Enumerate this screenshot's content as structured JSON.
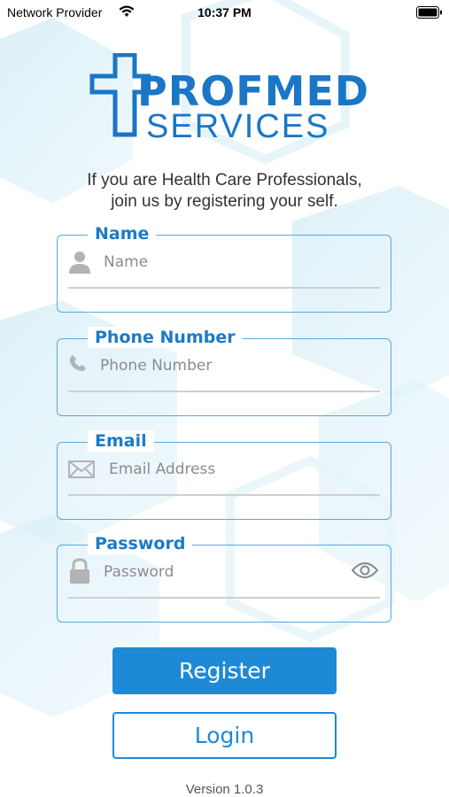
{
  "status_bar": {
    "carrier": "Network Provider",
    "time": "10:37 PM"
  },
  "logo": {
    "line1": "PROFMED",
    "line2": "SERVICES"
  },
  "tagline": {
    "line1": "If you are Health Care Professionals,",
    "line2": "join us by registering your self."
  },
  "form": {
    "name": {
      "label": "Name",
      "placeholder": "Name",
      "icon": "person-icon"
    },
    "phone": {
      "label": "Phone Number",
      "placeholder": "Phone Number",
      "icon": "phone-icon"
    },
    "email": {
      "label": "Email",
      "placeholder": "Email Address",
      "icon": "envelope-icon"
    },
    "password": {
      "label": "Password",
      "placeholder": "Password",
      "icon": "lock-icon",
      "toggle_icon": "eye-icon"
    }
  },
  "buttons": {
    "register": "Register",
    "login": "Login"
  },
  "footer": {
    "version": "Version 1.0.3"
  },
  "colors": {
    "primary": "#1e8ad6",
    "label": "#1b7bc8",
    "border": "#5aa8de"
  }
}
